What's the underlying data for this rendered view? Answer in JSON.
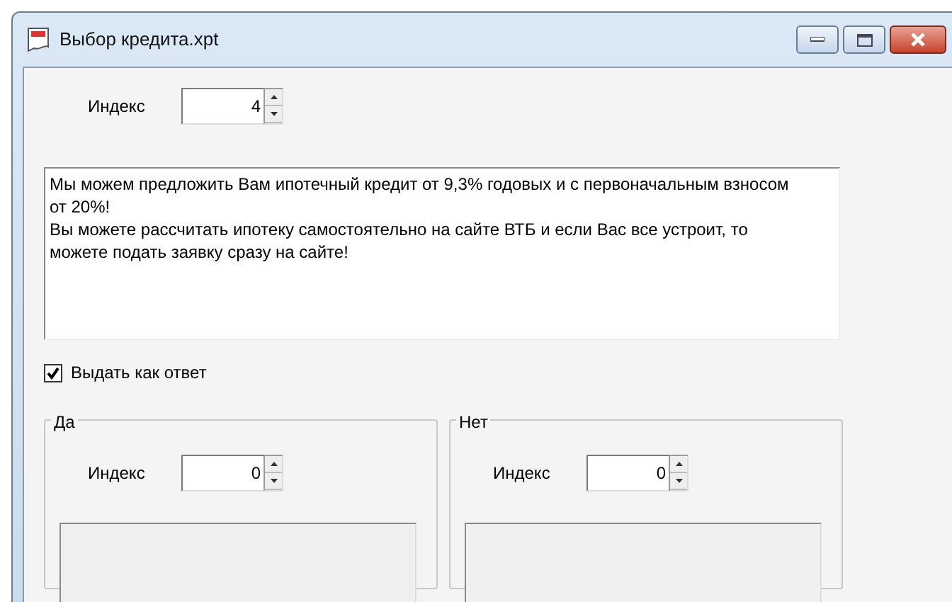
{
  "window": {
    "title": "Выбор кредита.xpt"
  },
  "index": {
    "label": "Индекс",
    "value": "4"
  },
  "message": {
    "text": "Мы можем предложить Вам ипотечный кредит от 9,3% годовых и с первоначальным взносом от 20%!\nВы можете рассчитать ипотеку самостоятельно на сайте ВТБ и если Вас все устроит, то можете подать заявку сразу на сайте!"
  },
  "answer_checkbox": {
    "label": "Выдать как ответ",
    "checked": true
  },
  "groups": [
    {
      "title": "Да",
      "index_label": "Индекс",
      "index_value": "0",
      "text_disabled": true
    },
    {
      "title": "Нет",
      "index_label": "Индекс",
      "index_value": "0",
      "text_disabled": true
    }
  ]
}
